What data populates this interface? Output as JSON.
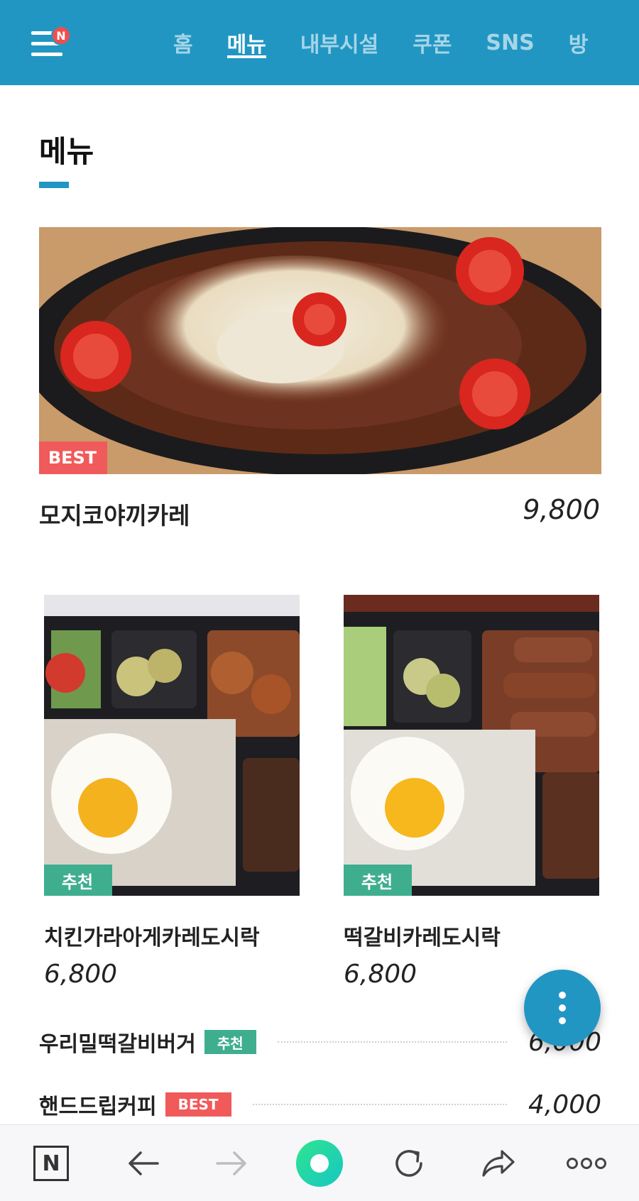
{
  "nav": {
    "menu_badge": "N",
    "tabs": [
      {
        "label": "홈"
      },
      {
        "label": "메뉴"
      },
      {
        "label": "내부시설"
      },
      {
        "label": "쿠폰"
      },
      {
        "label": "SNS"
      },
      {
        "label": "방"
      }
    ]
  },
  "section": {
    "title": "메뉴"
  },
  "featured": {
    "name": "모지코야끼카레",
    "price": "9,800",
    "tag": "BEST"
  },
  "grid": [
    {
      "name": "치킨가라아게카레도시락",
      "price": "6,800",
      "tag": "추천"
    },
    {
      "name": "떡갈비카레도시락",
      "price": "6,800",
      "tag": "추천"
    }
  ],
  "list": [
    {
      "name": "우리밀떡갈비버거",
      "tag": "추천",
      "price": "6,000"
    },
    {
      "name": "핸드드립커피",
      "tag": "BEST",
      "price": "4,000"
    }
  ],
  "bottom_bar": {
    "naver_label": "N"
  },
  "colors": {
    "primary": "#2196c3",
    "best": "#f05a5a",
    "recommend": "#3fae8e"
  }
}
